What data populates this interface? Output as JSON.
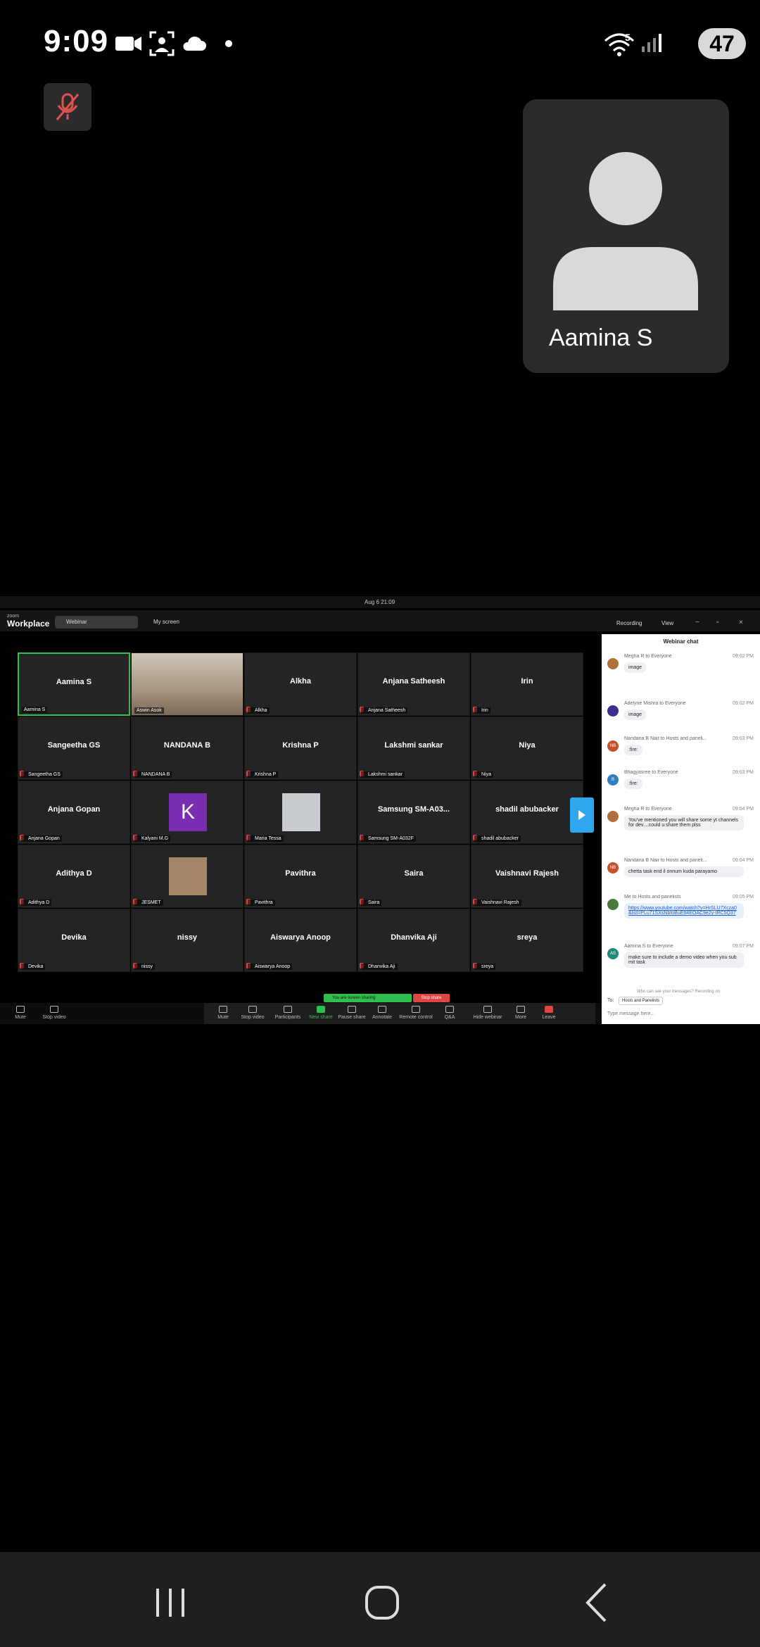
{
  "status_bar": {
    "time": "9:09",
    "battery": "47",
    "wifi_badge": "5"
  },
  "self_view": {
    "name": "Aamina S"
  },
  "desktop": {
    "date": "Aug 6  21:09",
    "app_title_small": "zoom",
    "app_title": "Workplace",
    "tab_webinar": "Webinar",
    "tab_myscreen": "My screen",
    "recording": "Recording",
    "view": "View"
  },
  "participants": [
    {
      "big": "Aamina S",
      "small": "Aamina S",
      "active": true,
      "muted": false
    },
    {
      "big": "",
      "small": "Aswin Asok",
      "video": true,
      "muted": false
    },
    {
      "big": "Alkha",
      "small": "Alkha",
      "muted": true
    },
    {
      "big": "Anjana Satheesh",
      "small": "Anjana Satheesh",
      "muted": true
    },
    {
      "big": "Irin",
      "small": "Irin",
      "muted": true
    },
    {
      "big": "Sangeetha GS",
      "small": "Sangeetha GS",
      "muted": true
    },
    {
      "big": "NANDANA B",
      "small": "NANDANA B",
      "muted": true
    },
    {
      "big": "Krishna P",
      "small": "Krishna P",
      "muted": true
    },
    {
      "big": "Lakshmi sankar",
      "small": "Lakshmi sankar",
      "muted": true
    },
    {
      "big": "Niya",
      "small": "Niya",
      "muted": true
    },
    {
      "big": "Anjana Gopan",
      "small": "Anjana Gopan",
      "muted": true
    },
    {
      "big": "",
      "small": "Kalyani M.G",
      "avatar": "K",
      "muted": true
    },
    {
      "big": "",
      "small": "Maria Tessa",
      "photo": "landscape",
      "muted": true
    },
    {
      "big": "Samsung SM-A03...",
      "small": "Samsung SM-A032F",
      "muted": true
    },
    {
      "big": "shadil abubacker",
      "small": "shadil abubacker",
      "muted": true
    },
    {
      "big": "Adithya D",
      "small": "Adithya D",
      "muted": true
    },
    {
      "big": "",
      "small": "JESMET",
      "photo": "portrait",
      "muted": true
    },
    {
      "big": "Pavithra",
      "small": "Pavithra",
      "muted": true
    },
    {
      "big": "Saira",
      "small": "Saira",
      "muted": true
    },
    {
      "big": "Vaishnavi Rajesh",
      "small": "Vaishnavi Rajesh",
      "muted": true
    },
    {
      "big": "Devika",
      "small": "Devika",
      "muted": true
    },
    {
      "big": "nissy",
      "small": "nissy",
      "muted": true
    },
    {
      "big": "Aiswarya Anoop",
      "small": "Aiswarya Anoop",
      "muted": true
    },
    {
      "big": "Dhanvika Aji",
      "small": "Dhanvika Aji",
      "muted": true
    },
    {
      "big": "sreya",
      "small": "sreya",
      "muted": true
    }
  ],
  "sharing": {
    "label": "You are screen sharing",
    "stop": "Stop share"
  },
  "toolbar": {
    "mute": "Mute",
    "stop_video": "Stop video",
    "participants": "Participants",
    "participants_count": "67",
    "new_share": "New share",
    "pause_share": "Pause share",
    "annotate": "Annotate",
    "remote_control": "Remote control",
    "qa": "Q&A",
    "hide_webinar": "Hide webinar",
    "more": "More",
    "leave": "Leave"
  },
  "chat": {
    "title": "Webinar chat",
    "messages": [
      {
        "initials": "",
        "color": "#b0703a",
        "head": "Megha R to Everyone",
        "time": "09:02 PM",
        "text": "image"
      },
      {
        "initials": "",
        "color": "#3b2f8c",
        "head": "Adelyne Mishra to Everyone",
        "time": "09:02 PM",
        "text": "image"
      },
      {
        "initials": "NB",
        "color": "#c6502b",
        "head": "Nandana B Nair to Hosts and paneli...",
        "time": "09:03 PM",
        "text": ":fire:"
      },
      {
        "initials": "B",
        "color": "#2e7fc2",
        "head": "Bhagyasree to Everyone",
        "time": "09:03 PM",
        "text": ":fire:"
      },
      {
        "initials": "",
        "color": "#b0703a",
        "head": "Megha R to Everyone",
        "time": "09:04 PM",
        "text": "You've mentioned you will share some yt channels for dev....could u share them plss"
      },
      {
        "initials": "NB",
        "color": "#c6502b",
        "head": "Nandana B Nair to Hosts and paneli...",
        "time": "09:04 PM",
        "text": "chetta task end il onnum kuda parayamo"
      },
      {
        "initials": "",
        "color": "#4a7a3a",
        "head": "Me to Hosts and panelists",
        "time": "09:05 PM",
        "text": "https://www.youtube.com/watch?v=HrSLU7Xcza0&list=PLu71SXsNbfoBuEtf4EOAC9e2y-tRC5Q37"
      },
      {
        "initials": "AS",
        "color": "#1f8a7a",
        "head": "Aamina S to Everyone",
        "time": "09:07 PM",
        "text": "make sure to include a demo video when you submit task"
      }
    ],
    "note": "Who can see your messages? Recording on",
    "to_label": "To:",
    "to_value": "Hosts and Panelists",
    "input_placeholder": "Type message here..."
  }
}
